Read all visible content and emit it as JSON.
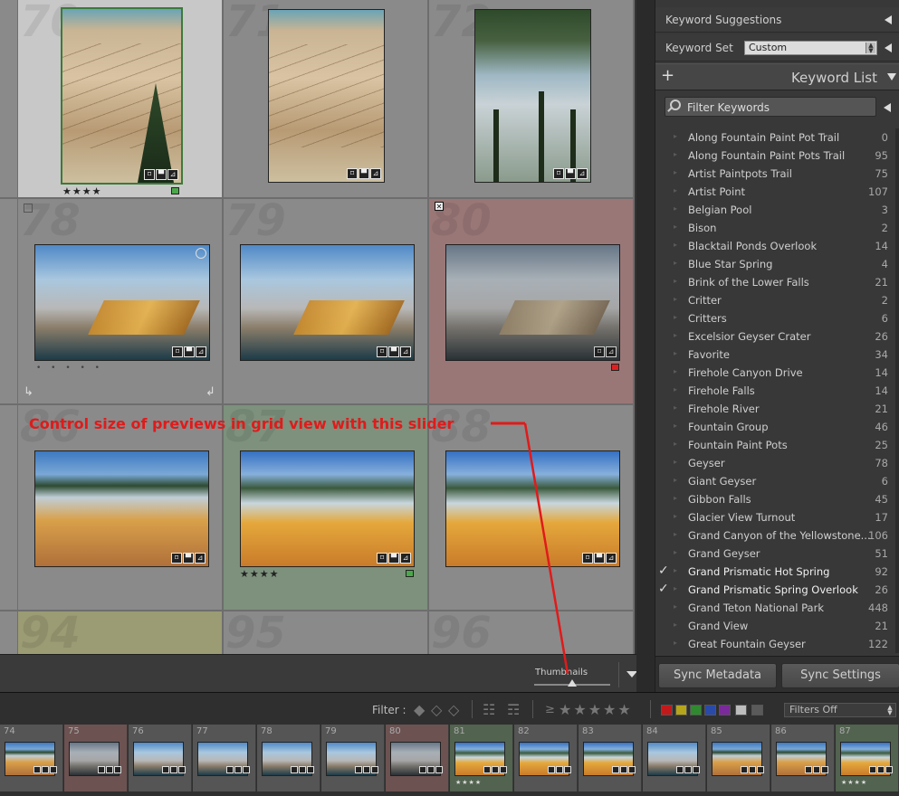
{
  "grid": {
    "cells": [
      {
        "num": "70",
        "stars": "★★★★"
      },
      {
        "num": "71"
      },
      {
        "num": "72"
      },
      {
        "num": "78"
      },
      {
        "num": "79"
      },
      {
        "num": "80"
      },
      {
        "num": "86"
      },
      {
        "num": "87",
        "stars": "★★★★"
      },
      {
        "num": "88"
      },
      {
        "num": "94"
      },
      {
        "num": "95"
      },
      {
        "num": "96"
      }
    ],
    "dots": "• • • • •"
  },
  "toolbar": {
    "thumbnails_label": "Thumbnails"
  },
  "annotation": {
    "text": "Control size of previews in grid view with this slider",
    "color": "#e11a1a"
  },
  "panel": {
    "keyword_suggestions": "Keyword Suggestions",
    "keyword_set_label": "Keyword Set",
    "keyword_set_value": "Custom",
    "keyword_list_title": "Keyword List",
    "filter_placeholder": "Filter Keywords",
    "keywords": [
      {
        "name": "Along Fountain Paint Pot Trail",
        "count": "0",
        "checked": false
      },
      {
        "name": "Along Fountain Paint Pots Trail",
        "count": "95",
        "checked": false
      },
      {
        "name": "Artist Paintpots Trail",
        "count": "75",
        "checked": false
      },
      {
        "name": "Artist Point",
        "count": "107",
        "checked": false
      },
      {
        "name": "Belgian Pool",
        "count": "3",
        "checked": false
      },
      {
        "name": "Bison",
        "count": "2",
        "checked": false
      },
      {
        "name": "Blacktail Ponds Overlook",
        "count": "14",
        "checked": false
      },
      {
        "name": "Blue Star Spring",
        "count": "4",
        "checked": false
      },
      {
        "name": "Brink of the Lower Falls",
        "count": "21",
        "checked": false
      },
      {
        "name": "Critter",
        "count": "2",
        "checked": false
      },
      {
        "name": "Critters",
        "count": "6",
        "checked": false
      },
      {
        "name": "Excelsior Geyser Crater",
        "count": "26",
        "checked": false
      },
      {
        "name": "Favorite",
        "count": "34",
        "checked": false
      },
      {
        "name": "Firehole Canyon Drive",
        "count": "14",
        "checked": false
      },
      {
        "name": "Firehole Falls",
        "count": "14",
        "checked": false
      },
      {
        "name": "Firehole River",
        "count": "21",
        "checked": false
      },
      {
        "name": "Fountain Group",
        "count": "46",
        "checked": false
      },
      {
        "name": "Fountain Paint Pots",
        "count": "25",
        "checked": false
      },
      {
        "name": "Geyser",
        "count": "78",
        "checked": false
      },
      {
        "name": "Giant Geyser",
        "count": "6",
        "checked": false
      },
      {
        "name": "Gibbon Falls",
        "count": "45",
        "checked": false
      },
      {
        "name": "Glacier View Turnout",
        "count": "17",
        "checked": false
      },
      {
        "name": "Grand Canyon of the Yellowstone...",
        "count": "106",
        "checked": false
      },
      {
        "name": "Grand Geyser",
        "count": "51",
        "checked": false
      },
      {
        "name": "Grand Prismatic Hot Spring",
        "count": "92",
        "checked": true
      },
      {
        "name": "Grand Prismatic Spring Overlook",
        "count": "26",
        "checked": true
      },
      {
        "name": "Grand Teton National Park",
        "count": "448",
        "checked": false
      },
      {
        "name": "Grand View",
        "count": "21",
        "checked": false
      },
      {
        "name": "Great Fountain Geyser",
        "count": "122",
        "checked": false
      }
    ],
    "sync_metadata": "Sync Metadata",
    "sync_settings": "Sync Settings"
  },
  "filterbar": {
    "filter_label": "Filter :",
    "ge_symbol": "≥",
    "stars": "★★★★★",
    "colors": [
      "#c21a1a",
      "#b5a51a",
      "#2f8a2f",
      "#2a4aa8",
      "#7a2a9a",
      "#bdbdbd",
      "#5a5a5a"
    ],
    "filters_off": "Filters Off"
  },
  "filmstrip": {
    "items": [
      {
        "num": "74",
        "stars": ""
      },
      {
        "num": "75",
        "stars": ""
      },
      {
        "num": "76",
        "stars": ""
      },
      {
        "num": "77",
        "stars": ""
      },
      {
        "num": "78",
        "stars": ""
      },
      {
        "num": "79",
        "stars": ""
      },
      {
        "num": "80",
        "stars": ""
      },
      {
        "num": "81",
        "stars": "★★★★"
      },
      {
        "num": "82",
        "stars": ""
      },
      {
        "num": "83",
        "stars": ""
      },
      {
        "num": "84",
        "stars": ""
      },
      {
        "num": "85",
        "stars": ""
      },
      {
        "num": "86",
        "stars": ""
      },
      {
        "num": "87",
        "stars": "★★★★"
      }
    ]
  }
}
